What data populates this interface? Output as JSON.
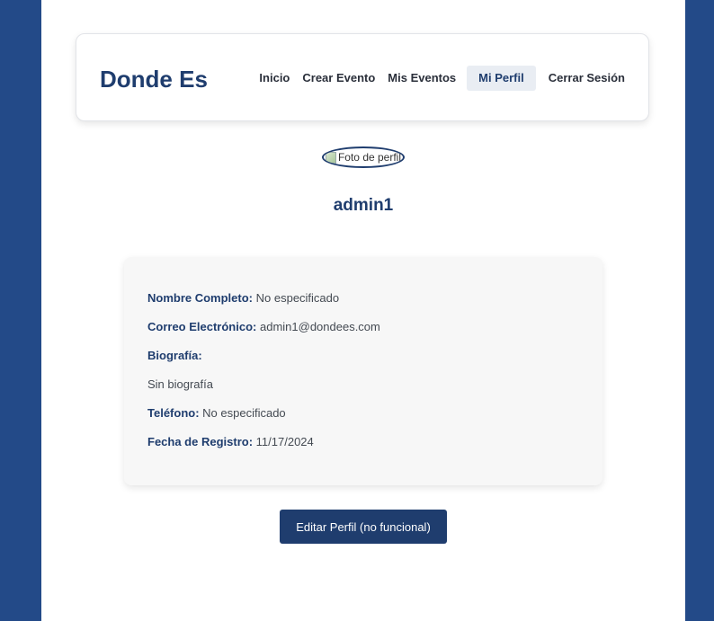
{
  "brand": "Donde Es",
  "nav": {
    "items": [
      {
        "label": "Inicio",
        "active": false
      },
      {
        "label": "Crear Evento",
        "active": false
      },
      {
        "label": "Mis Eventos",
        "active": false
      },
      {
        "label": "Mi Perfil",
        "active": true
      },
      {
        "label": "Cerrar Sesión",
        "active": false
      }
    ]
  },
  "profile": {
    "avatar_alt": "Foto de perfil",
    "username": "admin1",
    "fields": {
      "full_name_label": "Nombre Completo:",
      "full_name_value": "No especificado",
      "email_label": "Correo Electrónico:",
      "email_value": "admin1@dondees.com",
      "bio_label": "Biografía:",
      "bio_value": "Sin biografía",
      "phone_label": "Teléfono:",
      "phone_value": "No especificado",
      "registered_label": "Fecha de Registro:",
      "registered_value": "11/17/2024"
    },
    "edit_button": "Editar Perfil (no funcional)"
  },
  "colors": {
    "background": "#234a88",
    "primary": "#1f3d6e",
    "card": "#f7f7f7"
  }
}
